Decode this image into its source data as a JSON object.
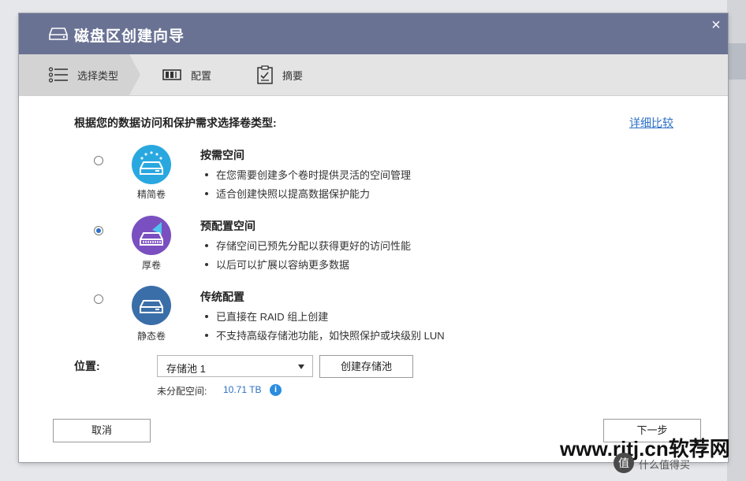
{
  "window": {
    "title": "磁盘区创建向导",
    "close_glyph": "×"
  },
  "steps": [
    {
      "label": "选择类型",
      "icon": "list-icon",
      "active": true
    },
    {
      "label": "配置",
      "icon": "disk-config-icon",
      "active": false
    },
    {
      "label": "摘要",
      "icon": "clipboard-icon",
      "active": false
    }
  ],
  "main": {
    "question": "根据您的数据访问和保护需求选择卷类型:",
    "compare_link": "详细比较",
    "options": [
      {
        "label": "精简卷",
        "title": "按需空间",
        "bullets": [
          "在您需要创建多个卷时提供灵活的空间管理",
          "适合创建快照以提高数据保护能力"
        ],
        "selected": false,
        "icon": "thin-volume-icon",
        "color": "#29a8e0"
      },
      {
        "label": "厚卷",
        "title": "预配置空间",
        "bullets": [
          "存储空间已预先分配以获得更好的访问性能",
          "以后可以扩展以容纳更多数据"
        ],
        "selected": true,
        "icon": "thick-volume-icon",
        "color": "#7a4fc0"
      },
      {
        "label": "静态卷",
        "title": "传统配置",
        "bullets": [
          "已直接在 RAID 组上创建",
          "不支持高级存储池功能，如快照保护或块级别 LUN"
        ],
        "selected": false,
        "icon": "static-volume-icon",
        "color": "#3a6ea8"
      }
    ],
    "location": {
      "label": "位置:",
      "select_value": "存储池 1",
      "create_pool_button": "创建存储池",
      "free_space_label": "未分配空间:",
      "free_space_value": "10.71 TB",
      "info_glyph": "i"
    }
  },
  "footer": {
    "cancel_button": "取消",
    "next_button": "下一步"
  },
  "watermark": {
    "text": "www.rjtj.cn软荐网",
    "sub": "什么值得买"
  }
}
